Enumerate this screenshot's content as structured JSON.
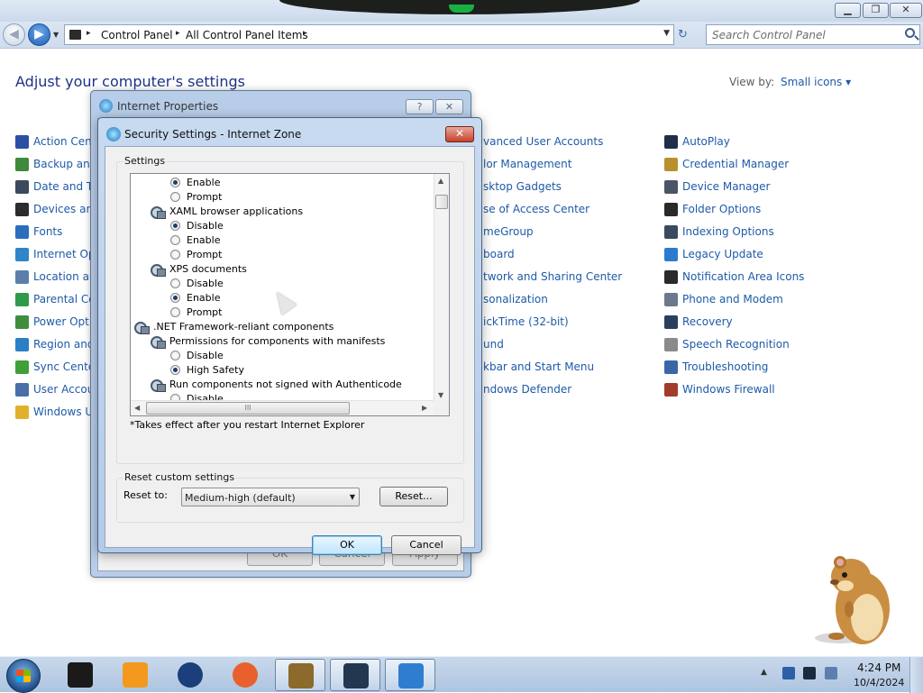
{
  "window": {
    "minimize_glyph": "▁",
    "maximize_glyph": "❐",
    "close_glyph": "✕"
  },
  "address": {
    "back_glyph": "◀",
    "forward_glyph": "▶",
    "breadcrumbs": [
      "Control Panel",
      "All Control Panel Items"
    ],
    "separator": "▸",
    "dropdown_glyph": "▼",
    "refresh_glyph": "↻",
    "search_placeholder": "Search Control Panel"
  },
  "control_panel": {
    "heading": "Adjust your computer's settings",
    "view_by_label": "View by:",
    "view_by_value": "Small icons ▾",
    "column1": [
      {
        "label": "Action Cent",
        "color": "#2b4fa3"
      },
      {
        "label": "Backup and",
        "color": "#3d8a3d"
      },
      {
        "label": "Date and Tir",
        "color": "#3b4a5c"
      },
      {
        "label": "Devices and",
        "color": "#2c2c2c"
      },
      {
        "label": "Fonts",
        "color": "#2a6fbd"
      },
      {
        "label": "Internet Opt",
        "color": "#2e86c8"
      },
      {
        "label": "Location an",
        "color": "#5b7fa8"
      },
      {
        "label": "Parental Co",
        "color": "#2f9b4a"
      },
      {
        "label": "Power Optio",
        "color": "#3e8e3e"
      },
      {
        "label": "Region and",
        "color": "#2b7fc4"
      },
      {
        "label": "Sync Center",
        "color": "#3fa037"
      },
      {
        "label": "User Accou",
        "color": "#4a6fa8"
      },
      {
        "label": "Windows Up",
        "color": "#e1b12c"
      }
    ],
    "column2": [
      {
        "label": "vanced User Accounts"
      },
      {
        "label": "lor Management"
      },
      {
        "label": "sktop Gadgets"
      },
      {
        "label": "se of Access Center"
      },
      {
        "label": "meGroup"
      },
      {
        "label": "board"
      },
      {
        "label": "twork and Sharing Center"
      },
      {
        "label": "sonalization"
      },
      {
        "label": "ickTime (32-bit)"
      },
      {
        "label": "und"
      },
      {
        "label": "kbar and Start Menu"
      },
      {
        "label": "ndows Defender"
      }
    ],
    "column3": [
      {
        "label": "AutoPlay",
        "color": "#1f2f4a"
      },
      {
        "label": "Credential Manager",
        "color": "#b8912e"
      },
      {
        "label": "Device Manager",
        "color": "#4b5566"
      },
      {
        "label": "Folder Options",
        "color": "#2a2a2a"
      },
      {
        "label": "Indexing Options",
        "color": "#3a4b5f"
      },
      {
        "label": "Legacy Update",
        "color": "#2a7bd0"
      },
      {
        "label": "Notification Area Icons",
        "color": "#2a2a2a"
      },
      {
        "label": "Phone and Modem",
        "color": "#6a7a8c"
      },
      {
        "label": "Recovery",
        "color": "#2b3e5c"
      },
      {
        "label": "Speech Recognition",
        "color": "#8a8a8a"
      },
      {
        "label": "Troubleshooting",
        "color": "#3b67a8"
      },
      {
        "label": "Windows Firewall",
        "color": "#a33b2b"
      }
    ]
  },
  "internet_properties": {
    "title": "Internet Properties",
    "help_glyph": "?",
    "close_glyph": "✕",
    "ok_label": "OK",
    "cancel_label": "Cancel",
    "apply_label": "Apply"
  },
  "security_settings": {
    "title": "Security Settings - Internet Zone",
    "close_glyph": "✕",
    "settings_group_label": "Settings",
    "tree_rows": [
      {
        "kind": "radio",
        "label": "Enable",
        "checked": true
      },
      {
        "kind": "radio",
        "label": "Prompt",
        "checked": false
      },
      {
        "kind": "setting",
        "label": "XAML browser applications"
      },
      {
        "kind": "radio",
        "label": "Disable",
        "checked": true
      },
      {
        "kind": "radio",
        "label": "Enable",
        "checked": false
      },
      {
        "kind": "radio",
        "label": "Prompt",
        "checked": false
      },
      {
        "kind": "setting",
        "label": "XPS documents"
      },
      {
        "kind": "radio",
        "label": "Disable",
        "checked": false
      },
      {
        "kind": "radio",
        "label": "Enable",
        "checked": true
      },
      {
        "kind": "radio",
        "label": "Prompt",
        "checked": false
      },
      {
        "kind": "category",
        "label": ".NET Framework-reliant components"
      },
      {
        "kind": "setting",
        "label": "Permissions for components with manifests"
      },
      {
        "kind": "radio",
        "label": "Disable",
        "checked": false
      },
      {
        "kind": "radio",
        "label": "High Safety",
        "checked": true
      },
      {
        "kind": "setting",
        "label": "Run components not signed with Authenticode"
      },
      {
        "kind": "radio",
        "label": "Disable",
        "checked": false
      }
    ],
    "scroll_up_glyph": "▲",
    "scroll_down_glyph": "▼",
    "scroll_left_glyph": "◀",
    "scroll_right_glyph": "▶",
    "hscroll_grip": "III",
    "note": "*Takes effect after you restart Internet Explorer",
    "reset_group_label": "Reset custom settings",
    "reset_to_label": "Reset to:",
    "reset_level": "Medium-high (default)",
    "reset_button": "Reset...",
    "ok_button": "OK",
    "cancel_button": "Cancel"
  },
  "taskbar": {
    "items": [
      {
        "name": "terminal",
        "color": "#1a1a1a",
        "active": false
      },
      {
        "name": "media-player",
        "color": "#f39a1e",
        "active": false
      },
      {
        "name": "globe",
        "color": "#1b3f7a",
        "active": false
      },
      {
        "name": "firefox",
        "color": "#e8612c",
        "active": false
      },
      {
        "name": "hamster-box",
        "color": "#8b6a2b",
        "active": true
      },
      {
        "name": "remote-desktop",
        "color": "#243750",
        "active": true
      },
      {
        "name": "control-panel",
        "color": "#2f7dd1",
        "active": true
      }
    ],
    "tray_arrow": "▲",
    "time": "4:24 PM",
    "date": "10/4/2024"
  }
}
